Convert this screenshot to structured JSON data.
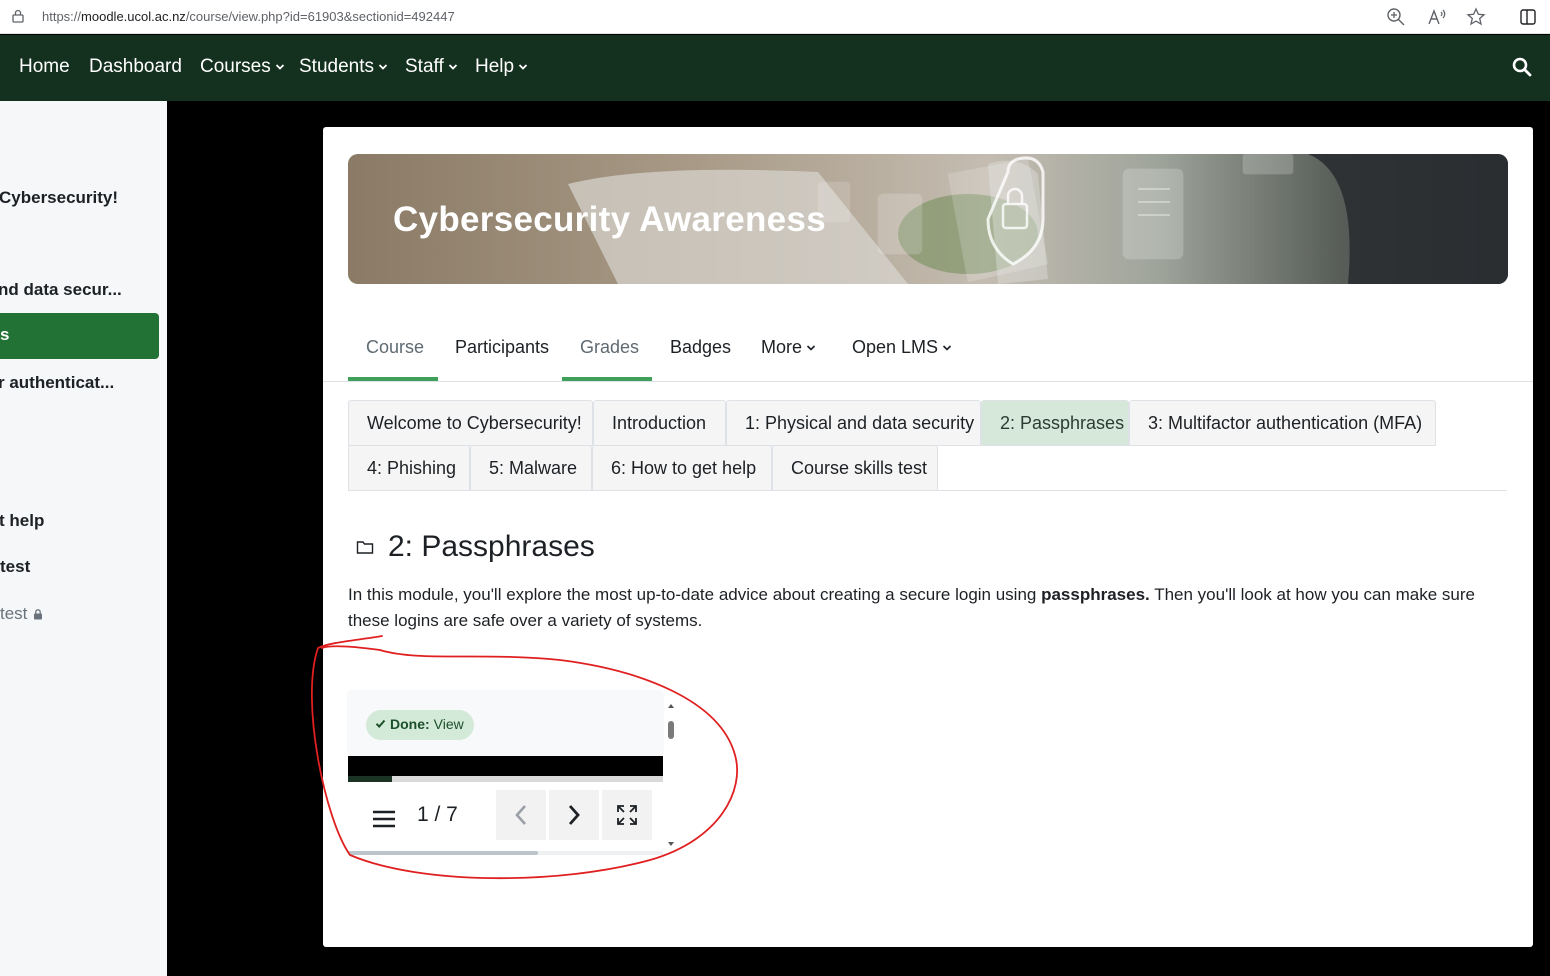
{
  "browser": {
    "url_prefix": "https://",
    "url_host": "moodle.ucol.ac.nz",
    "url_path": "/course/view.php?id=61903&sectionid=492447"
  },
  "navbar": {
    "items": [
      {
        "label": "Home"
      },
      {
        "label": "Dashboard"
      },
      {
        "label": "Courses"
      },
      {
        "label": "Students"
      },
      {
        "label": "Staff"
      },
      {
        "label": "Help"
      }
    ]
  },
  "drawer": {
    "items": [
      {
        "label": "Cybersecurity!"
      },
      {
        "label": "nd data secur..."
      },
      {
        "label": "s"
      },
      {
        "label": "r authenticat..."
      },
      {
        "label": "t help"
      },
      {
        "label": "test"
      },
      {
        "label": "test"
      }
    ]
  },
  "banner": {
    "title": "Cybersecurity Awareness"
  },
  "course_nav": {
    "items": [
      {
        "label": "Course"
      },
      {
        "label": "Participants"
      },
      {
        "label": "Grades"
      },
      {
        "label": "Badges"
      },
      {
        "label": "More"
      },
      {
        "label": "Open LMS"
      }
    ]
  },
  "section_tabs": [
    {
      "label": "Welcome to Cybersecurity!"
    },
    {
      "label": "Introduction"
    },
    {
      "label": "1: Physical and data security"
    },
    {
      "label": "2: Passphrases"
    },
    {
      "label": "3: Multifactor authentication (MFA)"
    },
    {
      "label": "4: Phishing"
    },
    {
      "label": "5: Malware"
    },
    {
      "label": "6: How to get help"
    },
    {
      "label": "Course skills test"
    }
  ],
  "section": {
    "title": "2: Passphrases",
    "summary_before": "In this module, you'll explore the most up-to-date advice about creating a secure login using ",
    "summary_bold": "passphrases.",
    "summary_after": " Then you'll look at how you can make sure these logins are safe over a variety of systems."
  },
  "activity": {
    "done_label": "Done:",
    "done_value": "View",
    "pager": "1 / 7",
    "progress": 0.14
  },
  "colors": {
    "navbar": "#14301f",
    "active_drawer": "#237235",
    "nav_underline": "#3fa05a",
    "active_tab": "#d6e8d9",
    "annotation": "#e02020"
  }
}
